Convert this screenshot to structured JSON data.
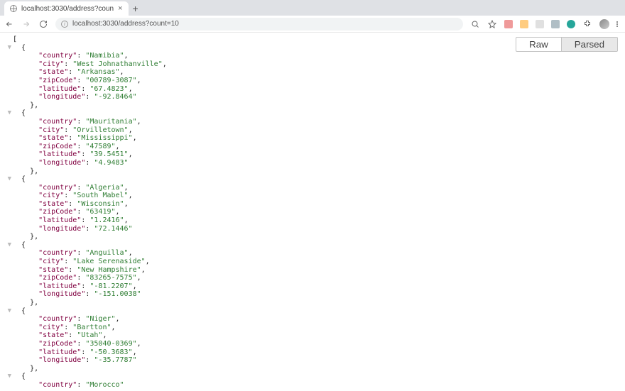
{
  "tab": {
    "title": "localhost:3030/address?coun"
  },
  "url": "localhost:3030/address?count=10",
  "toggle": {
    "raw": "Raw",
    "parsed": "Parsed"
  },
  "addresses": [
    {
      "country": "Namibia",
      "city": "West Johnathanville",
      "state": "Arkansas",
      "zipCode": "00789-3087",
      "latitude": "67.4823",
      "longitude": "-92.8464"
    },
    {
      "country": "Mauritania",
      "city": "Orvilletown",
      "state": "Mississippi",
      "zipCode": "47589",
      "latitude": "39.5451",
      "longitude": "4.9483"
    },
    {
      "country": "Algeria",
      "city": "South Mabel",
      "state": "Wisconsin",
      "zipCode": "63419",
      "latitude": "1.2416",
      "longitude": "72.1446"
    },
    {
      "country": "Anguilla",
      "city": "Lake Serenaside",
      "state": "New Hampshire",
      "zipCode": "83265-7575",
      "latitude": "-81.2207",
      "longitude": "-151.0038"
    },
    {
      "country": "Niger",
      "city": "Bartton",
      "state": "Utah",
      "zipCode": "35040-0369",
      "latitude": "-50.3683",
      "longitude": "-35.7787"
    },
    {
      "country": "Morocco"
    }
  ],
  "json_keys": [
    "country",
    "city",
    "state",
    "zipCode",
    "latitude",
    "longitude"
  ]
}
